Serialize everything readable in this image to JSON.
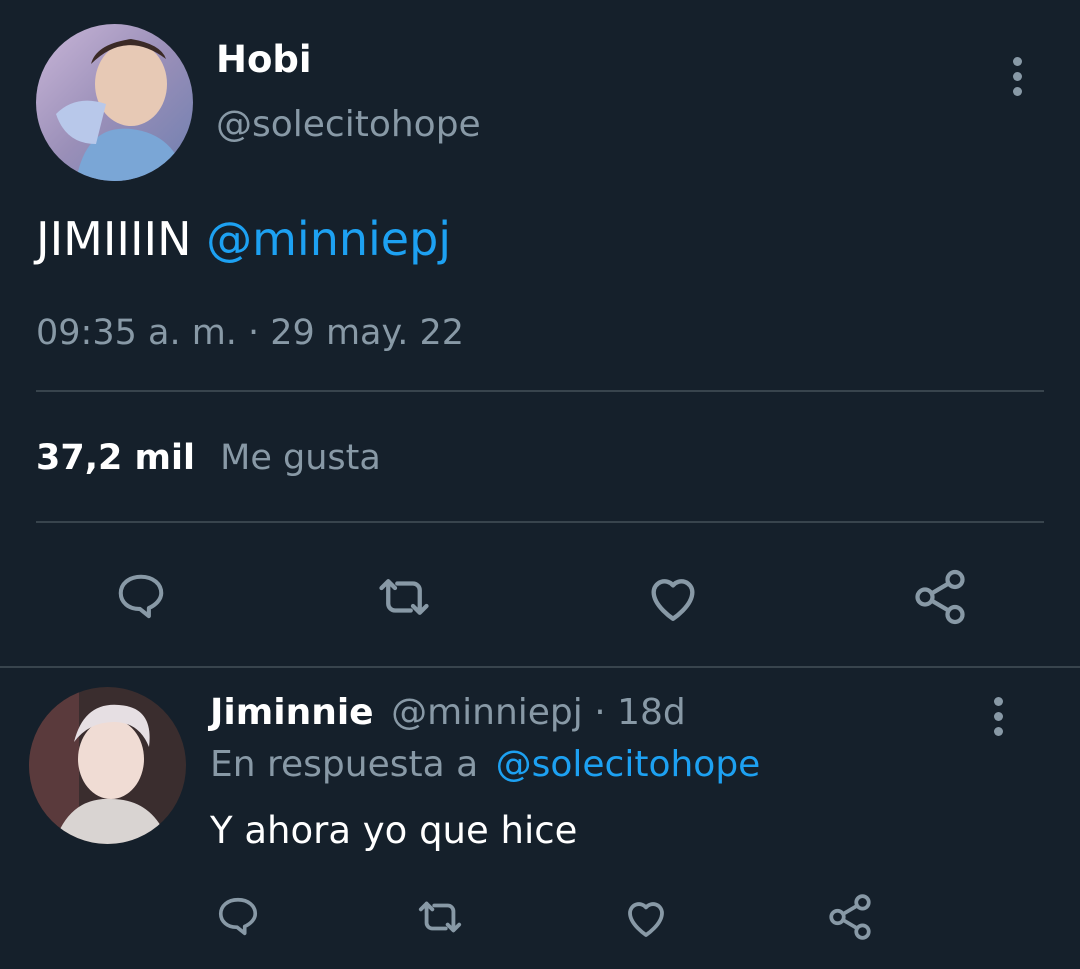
{
  "tweet": {
    "author_name": "Hobi",
    "author_handle": "@solecitohope",
    "text_main": "JIMIIIIN",
    "text_mention": "@minniepj",
    "timestamp": "09:35 a. m. · 29 may. 22",
    "likes_count": "37,2 mil",
    "likes_label": "Me gusta"
  },
  "reply": {
    "author_name": "Jiminnie",
    "author_handle": "@minniepj",
    "separator": " · ",
    "age": "18d",
    "replying_prefix": "En respuesta a",
    "replying_handle": "@solecitohope",
    "text": "Y ahora yo que hice"
  },
  "colors": {
    "background": "#15202b",
    "text": "#ffffff",
    "secondary": "#8899a6",
    "accent": "#1da1f2",
    "divider": "#38444d"
  },
  "icons": [
    "reply-icon",
    "retweet-icon",
    "like-icon",
    "share-icon",
    "more-options-icon"
  ]
}
